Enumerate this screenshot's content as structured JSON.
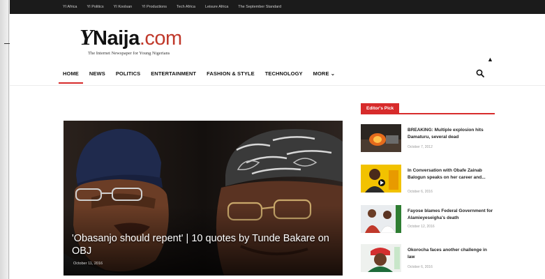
{
  "topbar": {
    "links": [
      "YI Africa",
      "YI Politics",
      "YI Koolsan",
      "YI Productions",
      "Tech Africa",
      "Leisure Africa",
      "The September Standard"
    ]
  },
  "logo": {
    "y_letter": "Y",
    "name": "Naija",
    "domain": ".com",
    "tagline": "The Internet Newspaper for Young Nigerians"
  },
  "nav": {
    "items": [
      "HOME",
      "NEWS",
      "POLITICS",
      "ENTERTAINMENT",
      "FASHION & STYLE",
      "TECHNOLOGY",
      "MORE ⌄"
    ],
    "active_index": 0
  },
  "hero": {
    "title": "'Obasanjo should repent' | 10 quotes by Tunde Bakare on OBJ",
    "date": "October 11, 2016"
  },
  "sidebar": {
    "heading": "Editor's Pick",
    "items": [
      {
        "title": "BREAKING: Multiple explosion hits Damaturu, several dead",
        "date": "October 7, 2012"
      },
      {
        "title": "In Conversation with Obafe Zainab Balogun speaks on her career and...",
        "date": "October 6, 2016"
      },
      {
        "title": "Fayose blames Federal Government for Alamieyeseigha's death",
        "date": "October 12, 2016"
      },
      {
        "title": "Okorocha faces another challenge in law",
        "date": "October 6, 2016"
      }
    ]
  },
  "colors": {
    "accent": "#d72b2b",
    "topbar": "#1b1b1b"
  }
}
